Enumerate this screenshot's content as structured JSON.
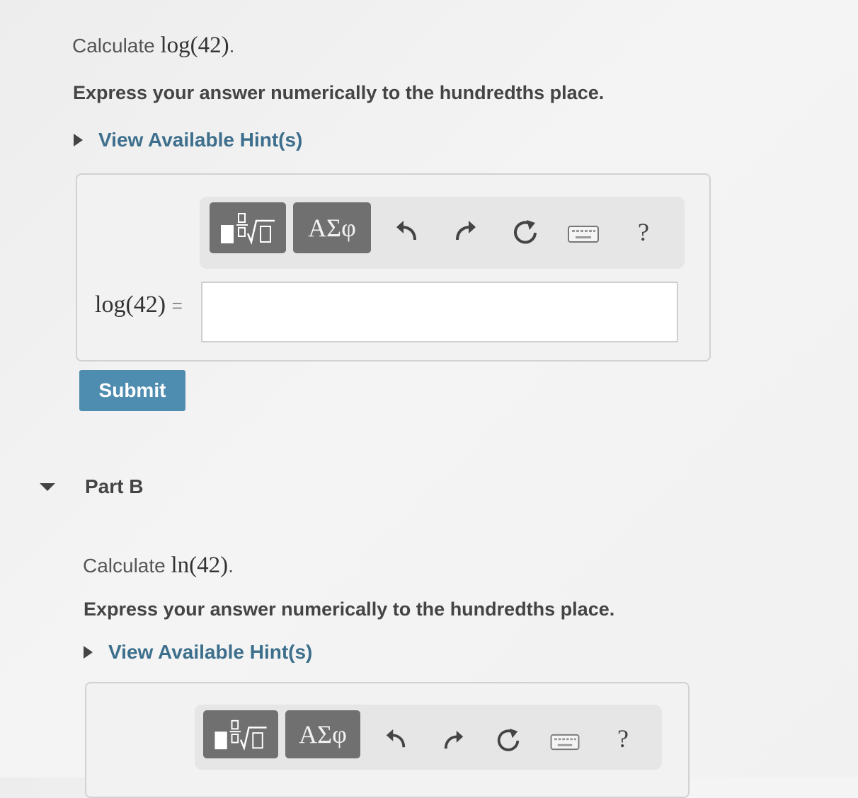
{
  "partA": {
    "calculate_prefix": "Calculate",
    "calculate_expr": "log(42)",
    "calculate_suffix": ".",
    "instruction": "Express your answer numerically to the hundredths place.",
    "hint_link": "View Available Hint(s)",
    "equation_label": "log(42)",
    "equals": "=",
    "answer_value": "",
    "submit_label": "Submit"
  },
  "toolbar": {
    "greek_label": "ΑΣφ",
    "help_label": "?",
    "icons": [
      "templates-icon",
      "greek-letters-icon",
      "undo-icon",
      "redo-icon",
      "reset-icon",
      "keyboard-icon",
      "help-icon"
    ]
  },
  "partB": {
    "title": "Part B",
    "calculate_prefix": "Calculate",
    "calculate_expr": "ln(42)",
    "calculate_suffix": ".",
    "instruction": "Express your answer numerically to the hundredths place.",
    "hint_link": "View Available Hint(s)"
  },
  "colors": {
    "link": "#3d6f8c",
    "submit": "#4f8db0",
    "toolbar_button": "#707070"
  }
}
